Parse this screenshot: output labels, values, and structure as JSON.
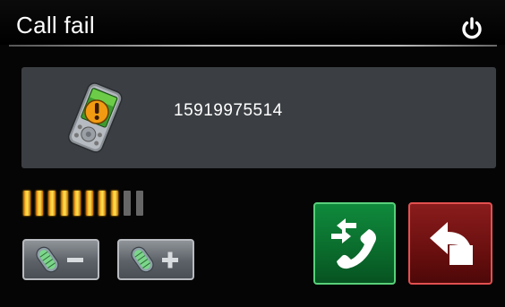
{
  "header": {
    "title": "Call fail",
    "power_icon": "power-icon"
  },
  "call": {
    "phone_number": "15919975514",
    "status_icon": "device-warning-icon"
  },
  "volume": {
    "level": 8,
    "max": 10
  },
  "controls": {
    "volume_down_icon": "mic-minus-icon",
    "volume_up_icon": "mic-plus-icon",
    "redial_icon": "redial-icon",
    "back_icon": "back-arrow-icon"
  },
  "colors": {
    "call_button": "#0a6b2c",
    "back_button": "#6a0f0f",
    "volume_on": "#ffcc33",
    "volume_off": "#666666",
    "panel": "#3b3f43"
  }
}
